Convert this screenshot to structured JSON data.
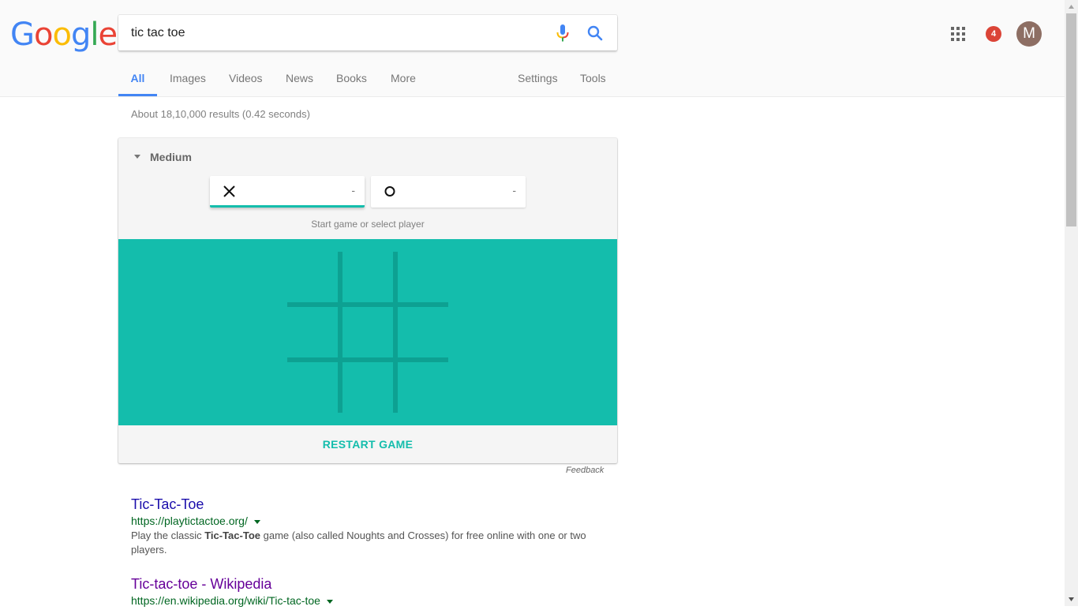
{
  "header": {
    "logo": {
      "letters": [
        "G",
        "o",
        "o",
        "g",
        "l",
        "e"
      ],
      "colors": [
        "#4285f4",
        "#ea4335",
        "#fbbc05",
        "#4285f4",
        "#34a853",
        "#ea4335"
      ]
    },
    "search": {
      "value": "tic tac toe",
      "placeholder": ""
    },
    "notifications_count": "4",
    "avatar_initial": "M"
  },
  "tabs": [
    {
      "label": "All",
      "active": true
    },
    {
      "label": "Images"
    },
    {
      "label": "Videos"
    },
    {
      "label": "News"
    },
    {
      "label": "Books"
    },
    {
      "label": "More"
    },
    {
      "label": "Settings"
    },
    {
      "label": "Tools"
    }
  ],
  "result_stats": "About 18,10,000 results (0.42 seconds)",
  "game": {
    "difficulty": "Medium",
    "players": [
      {
        "symbol": "X",
        "score": "-",
        "active": true
      },
      {
        "symbol": "O",
        "score": "-",
        "active": false
      }
    ],
    "status": "Start game or select player",
    "board": [
      "",
      "",
      "",
      "",
      "",
      "",
      "",
      "",
      ""
    ],
    "restart_label": "RESTART GAME",
    "accent_color": "#14bdac"
  },
  "feedback_label": "Feedback",
  "results": [
    {
      "title": "Tic-Tac-Toe",
      "url": "https://playtictactoe.org/",
      "snippet_before": "Play the classic ",
      "snippet_bold": "Tic-Tac-Toe",
      "snippet_after": " game (also called Noughts and Crosses) for free online with one or two players.",
      "visited": false
    },
    {
      "title": "Tic-tac-toe - Wikipedia",
      "url": "https://en.wikipedia.org/wiki/Tic-tac-toe",
      "visited": true
    }
  ]
}
